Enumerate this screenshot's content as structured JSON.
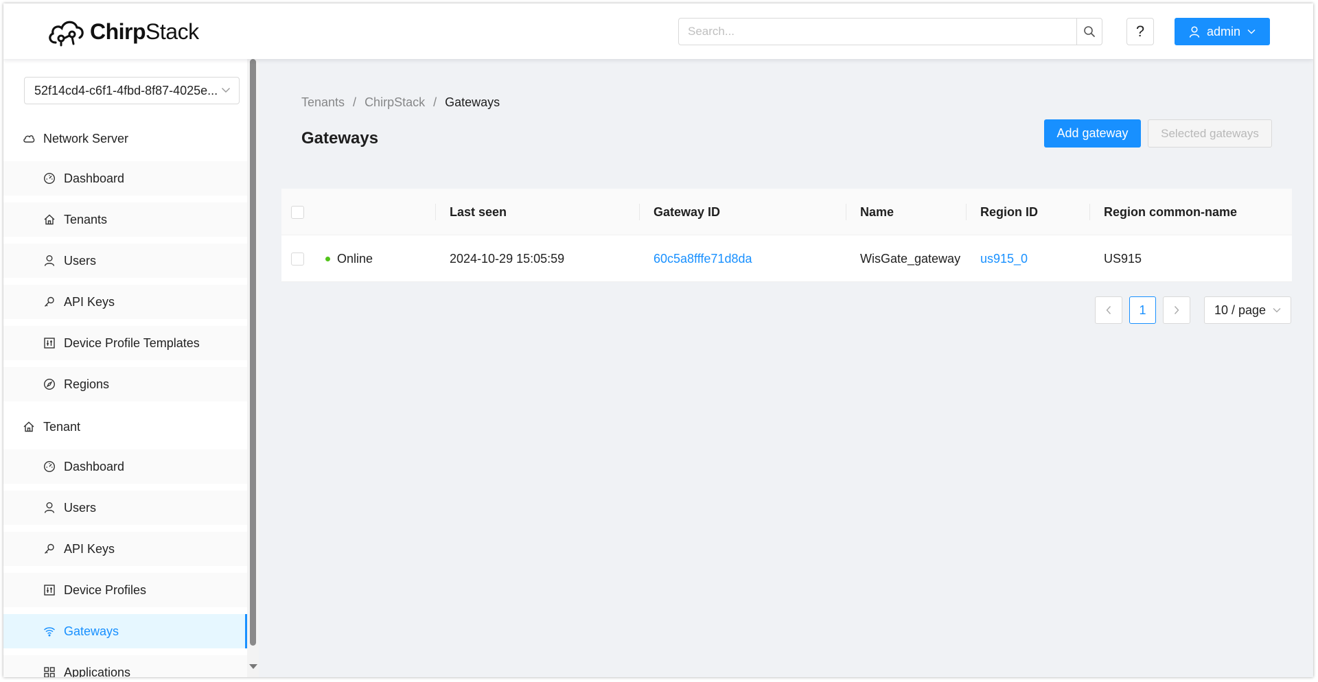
{
  "app": {
    "logo_text_bold": "Chirp",
    "logo_text_light": "Stack"
  },
  "header": {
    "search_placeholder": "Search...",
    "help_label": "?",
    "user_label": "admin"
  },
  "sidebar": {
    "tenant_select_value": "52f14cd4-c6f1-4fbd-8f87-4025e...",
    "network_server": {
      "label": "Network Server",
      "items": [
        "Dashboard",
        "Tenants",
        "Users",
        "API Keys",
        "Device Profile Templates",
        "Regions"
      ]
    },
    "tenant": {
      "label": "Tenant",
      "items": [
        "Dashboard",
        "Users",
        "API Keys",
        "Device Profiles",
        "Gateways",
        "Applications"
      ]
    },
    "active_item": "Gateways"
  },
  "breadcrumb": [
    "Tenants",
    "ChirpStack",
    "Gateways"
  ],
  "breadcrumb_separator": "/",
  "page": {
    "title": "Gateways",
    "add_button": "Add gateway",
    "selected_button": "Selected gateways"
  },
  "table": {
    "columns": [
      "",
      "Last seen",
      "Gateway ID",
      "Name",
      "Region ID",
      "Region common-name"
    ],
    "rows": [
      {
        "status": "Online",
        "last_seen": "2024-10-29 15:05:59",
        "gateway_id": "60c5a8fffe71d8da",
        "name": "WisGate_gateway",
        "region_id": "us915_0",
        "region_common_name": "US915"
      }
    ]
  },
  "pagination": {
    "prev": "<",
    "current_page": "1",
    "next": ">",
    "page_size": "10 / page"
  },
  "colors": {
    "primary": "#1890ff",
    "online": "#52c41a"
  }
}
